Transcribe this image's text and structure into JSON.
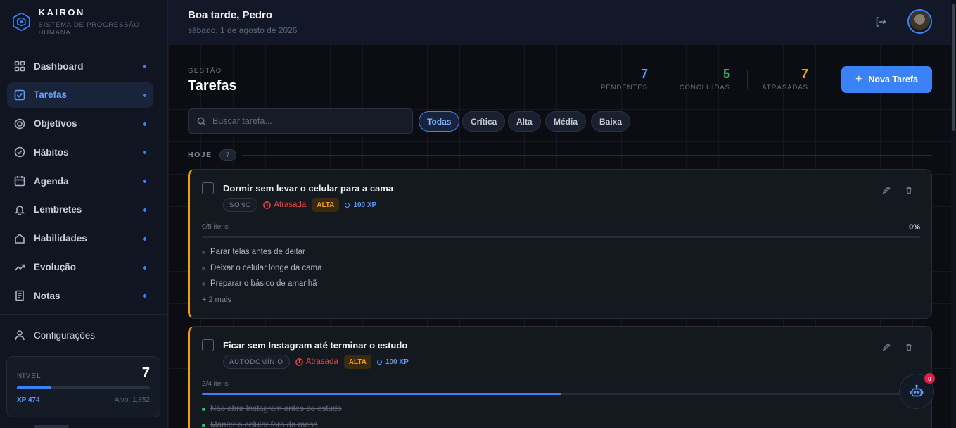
{
  "brand": {
    "name": "KAIRON",
    "subtitle": "SISTEMA DE PROGRESSÃO HUMANA"
  },
  "sidebar": {
    "items": [
      {
        "label": "Dashboard",
        "icon": "grid-icon",
        "active": false
      },
      {
        "label": "Tarefas",
        "icon": "checkbox-icon",
        "active": true
      },
      {
        "label": "Objetivos",
        "icon": "target-icon",
        "active": false
      },
      {
        "label": "Hábitos",
        "icon": "check-circle-icon",
        "active": false
      },
      {
        "label": "Agenda",
        "icon": "calendar-icon",
        "active": false
      },
      {
        "label": "Lembretes",
        "icon": "bell-icon",
        "active": false
      },
      {
        "label": "Habilidades",
        "icon": "home-icon",
        "active": false
      },
      {
        "label": "Evolução",
        "icon": "trend-icon",
        "active": false
      },
      {
        "label": "Notas",
        "icon": "note-icon",
        "active": false
      }
    ],
    "config_label": "Configurações",
    "level": {
      "label": "NÍVEL",
      "value": "7",
      "xp": "XP 474",
      "goal": "Alvo: 1,852",
      "progress": 0.26
    }
  },
  "header": {
    "greeting": "Boa tarde, Pedro",
    "date": "sábado, 1 de agosto de 2026"
  },
  "main": {
    "kicker": "GESTÃO",
    "title": "Tarefas",
    "stats": [
      {
        "value": "7",
        "label": "PENDENTES",
        "color": "#5b9cff"
      },
      {
        "value": "5",
        "label": "CONCLUÍDAS",
        "color": "#22c55e"
      },
      {
        "value": "7",
        "label": "ATRASADAS",
        "color": "#f59e0b"
      }
    ],
    "new_button": "Nova Tarefa",
    "search_placeholder": "Buscar tarefa...",
    "filters": [
      "Todas",
      "Crítica",
      "Alta",
      "Média",
      "Baixa"
    ],
    "group": {
      "label": "HOJE",
      "count": "7"
    },
    "tasks": [
      {
        "title": "Dormir sem levar o celular para a cama",
        "tag": "SONO",
        "status": "Atrasada",
        "priority": "ALTA",
        "xp": "100 XP",
        "progress_text": "0/5 itens",
        "percent": "0%",
        "progress": 0,
        "subtasks": [
          "Parar telas antes de deitar",
          "Deixar o celular longe da cama",
          "Preparar o básico de amanhã"
        ],
        "more": "+ 2 mais"
      },
      {
        "title": "Ficar sem Instagram até terminar o estudo",
        "tag": "AUTODOMÍNIO",
        "status": "Atrasada",
        "priority": "ALTA",
        "xp": "100 XP",
        "progress_text": "2/4 itens",
        "progress": 0.5,
        "subtasks": [
          "Não abrir Instagram antes do estudo",
          "Manter o celular fora da mesa"
        ]
      }
    ]
  },
  "assistant": {
    "badge": "0"
  }
}
